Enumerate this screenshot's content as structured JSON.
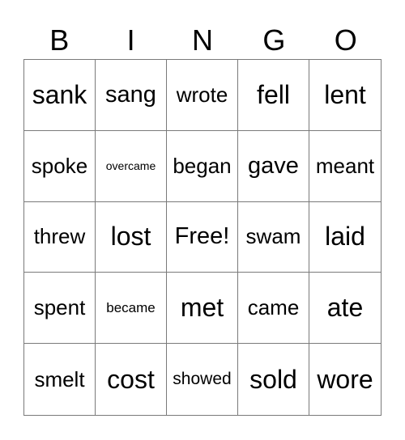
{
  "header": {
    "letters": [
      "B",
      "I",
      "N",
      "G",
      "O"
    ]
  },
  "board": {
    "rows": [
      [
        "sank",
        "sang",
        "wrote",
        "fell",
        "lent"
      ],
      [
        "spoke",
        "overcame",
        "began",
        "gave",
        "meant"
      ],
      [
        "threw",
        "lost",
        "Free!",
        "swam",
        "laid"
      ],
      [
        "spent",
        "became",
        "met",
        "came",
        "ate"
      ],
      [
        "smelt",
        "cost",
        "showed",
        "sold",
        "wore"
      ]
    ]
  },
  "colors": {
    "grid_line": "#7a7a7a",
    "text": "#000000",
    "background": "#ffffff"
  }
}
